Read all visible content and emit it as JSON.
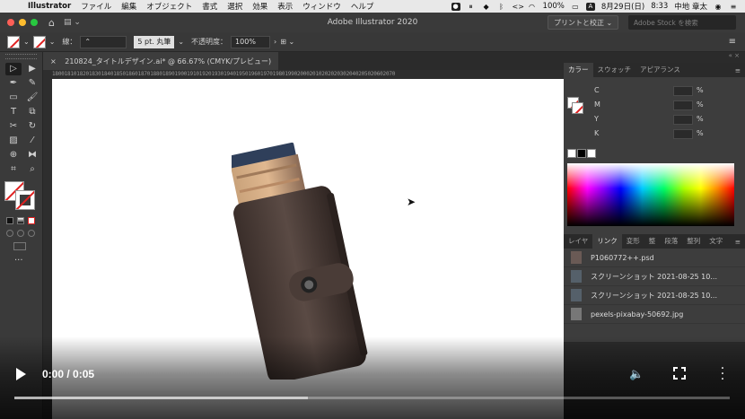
{
  "menubar": {
    "app_name": "Illustrator",
    "items": [
      "ファイル",
      "編集",
      "オブジェクト",
      "書式",
      "選択",
      "効果",
      "表示",
      "ウィンドウ",
      "ヘルプ"
    ],
    "battery": "100%",
    "date": "8月29日(日)",
    "time": "8:33",
    "user": "中地 章太"
  },
  "appbar": {
    "title": "Adobe Illustrator 2020",
    "print_button": "プリントと校正 ⌄",
    "search_placeholder": "Adobe Stock を検索"
  },
  "controlbar": {
    "stroke_label": "線：",
    "stroke_style": "5 pt. 丸筆",
    "opacity_label": "不透明度：",
    "opacity_value": "100%"
  },
  "document": {
    "tab_label": "210824_タイトルデザイン.ai* @ 66.67% (CMYK/プレビュー)",
    "ruler_text": "1800181018201830184018501860187018801890190019101920193019401950196019701980199020002010202020302040205020602070"
  },
  "color_panel": {
    "tabs": [
      "カラー",
      "スウォッチ",
      "アピアランス"
    ],
    "channels": [
      {
        "label": "C",
        "unit": "%"
      },
      {
        "label": "M",
        "unit": "%"
      },
      {
        "label": "Y",
        "unit": "%"
      },
      {
        "label": "K",
        "unit": "%"
      }
    ]
  },
  "links_panel": {
    "tabs": [
      "レイヤ",
      "リンク",
      "変形",
      "整",
      "段落",
      "整列",
      "文字"
    ],
    "items": [
      "P1060772++.psd",
      "スクリーンショット 2021-08-25 10...",
      "スクリーンショット 2021-08-25 10...",
      "pexels-pixabay-50692.jpg"
    ]
  },
  "video": {
    "time_current": "0:00",
    "time_total": "0:05",
    "buffered_fraction": 0.41
  }
}
